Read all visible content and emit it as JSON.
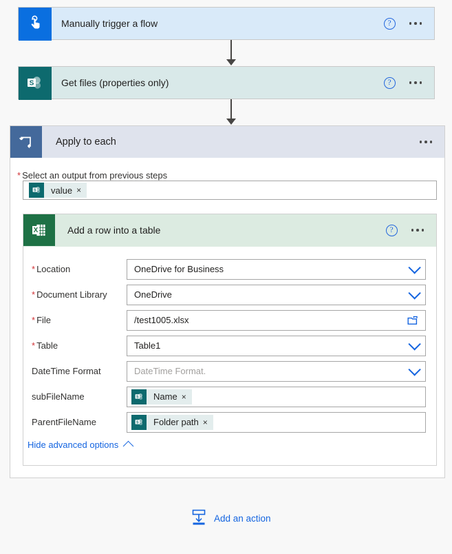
{
  "flow": {
    "trigger": {
      "title": "Manually trigger a flow",
      "icon": "hand-pointer-icon",
      "icon_color": "#0a6fe0",
      "card_color": "#d9eaf9",
      "help_label": "?",
      "menu_label": "..."
    },
    "get_files": {
      "title": "Get files (properties only)",
      "icon": "sharepoint-icon",
      "icon_color": "#0d6a6e",
      "card_color": "#d9e9e9",
      "help_label": "?",
      "menu_label": "..."
    },
    "apply_to_each": {
      "title": "Apply to each",
      "icon": "loop-icon",
      "icon_color": "#44699b",
      "card_color": "#dfe3ed",
      "menu_label": "...",
      "select_output": {
        "label": "Select an output from previous steps",
        "required": true,
        "token": {
          "text": "value",
          "icon": "sharepoint-icon",
          "close_label": "×"
        }
      }
    },
    "add_row_action": {
      "title": "Add a row into a table",
      "icon": "excel-icon",
      "icon_color": "#1e7145",
      "card_color": "#dcebe1",
      "help_label": "?",
      "menu_label": "...",
      "fields": [
        {
          "label": "Location",
          "required": true,
          "value": "OneDrive for Business",
          "control": "dropdown",
          "name": "location"
        },
        {
          "label": "Document Library",
          "required": true,
          "value": "OneDrive",
          "control": "dropdown",
          "name": "document-library"
        },
        {
          "label": "File",
          "required": true,
          "value": "/test1005.xlsx",
          "control": "file-picker",
          "name": "file"
        },
        {
          "label": "Table",
          "required": true,
          "value": "Table1",
          "control": "dropdown",
          "name": "table"
        },
        {
          "label": "DateTime Format",
          "required": false,
          "value": "",
          "placeholder": "DateTime Format.",
          "control": "dropdown",
          "name": "datetime-format"
        },
        {
          "label": "subFileName",
          "required": false,
          "control": "token",
          "name": "subfilename",
          "token": {
            "text": "Name",
            "icon": "sharepoint-icon",
            "close_label": "×"
          }
        },
        {
          "label": "ParentFileName",
          "required": false,
          "control": "token",
          "name": "parentfilename",
          "token": {
            "text": "Folder path",
            "icon": "sharepoint-icon",
            "close_label": "×"
          }
        }
      ],
      "advanced_options_label": "Hide advanced options"
    },
    "add_action": {
      "label": "Add an action",
      "icon": "add-action-icon"
    },
    "colors": {
      "accent_blue": "#1565e0",
      "required_red": "#d13438",
      "connector": "#484644"
    }
  }
}
